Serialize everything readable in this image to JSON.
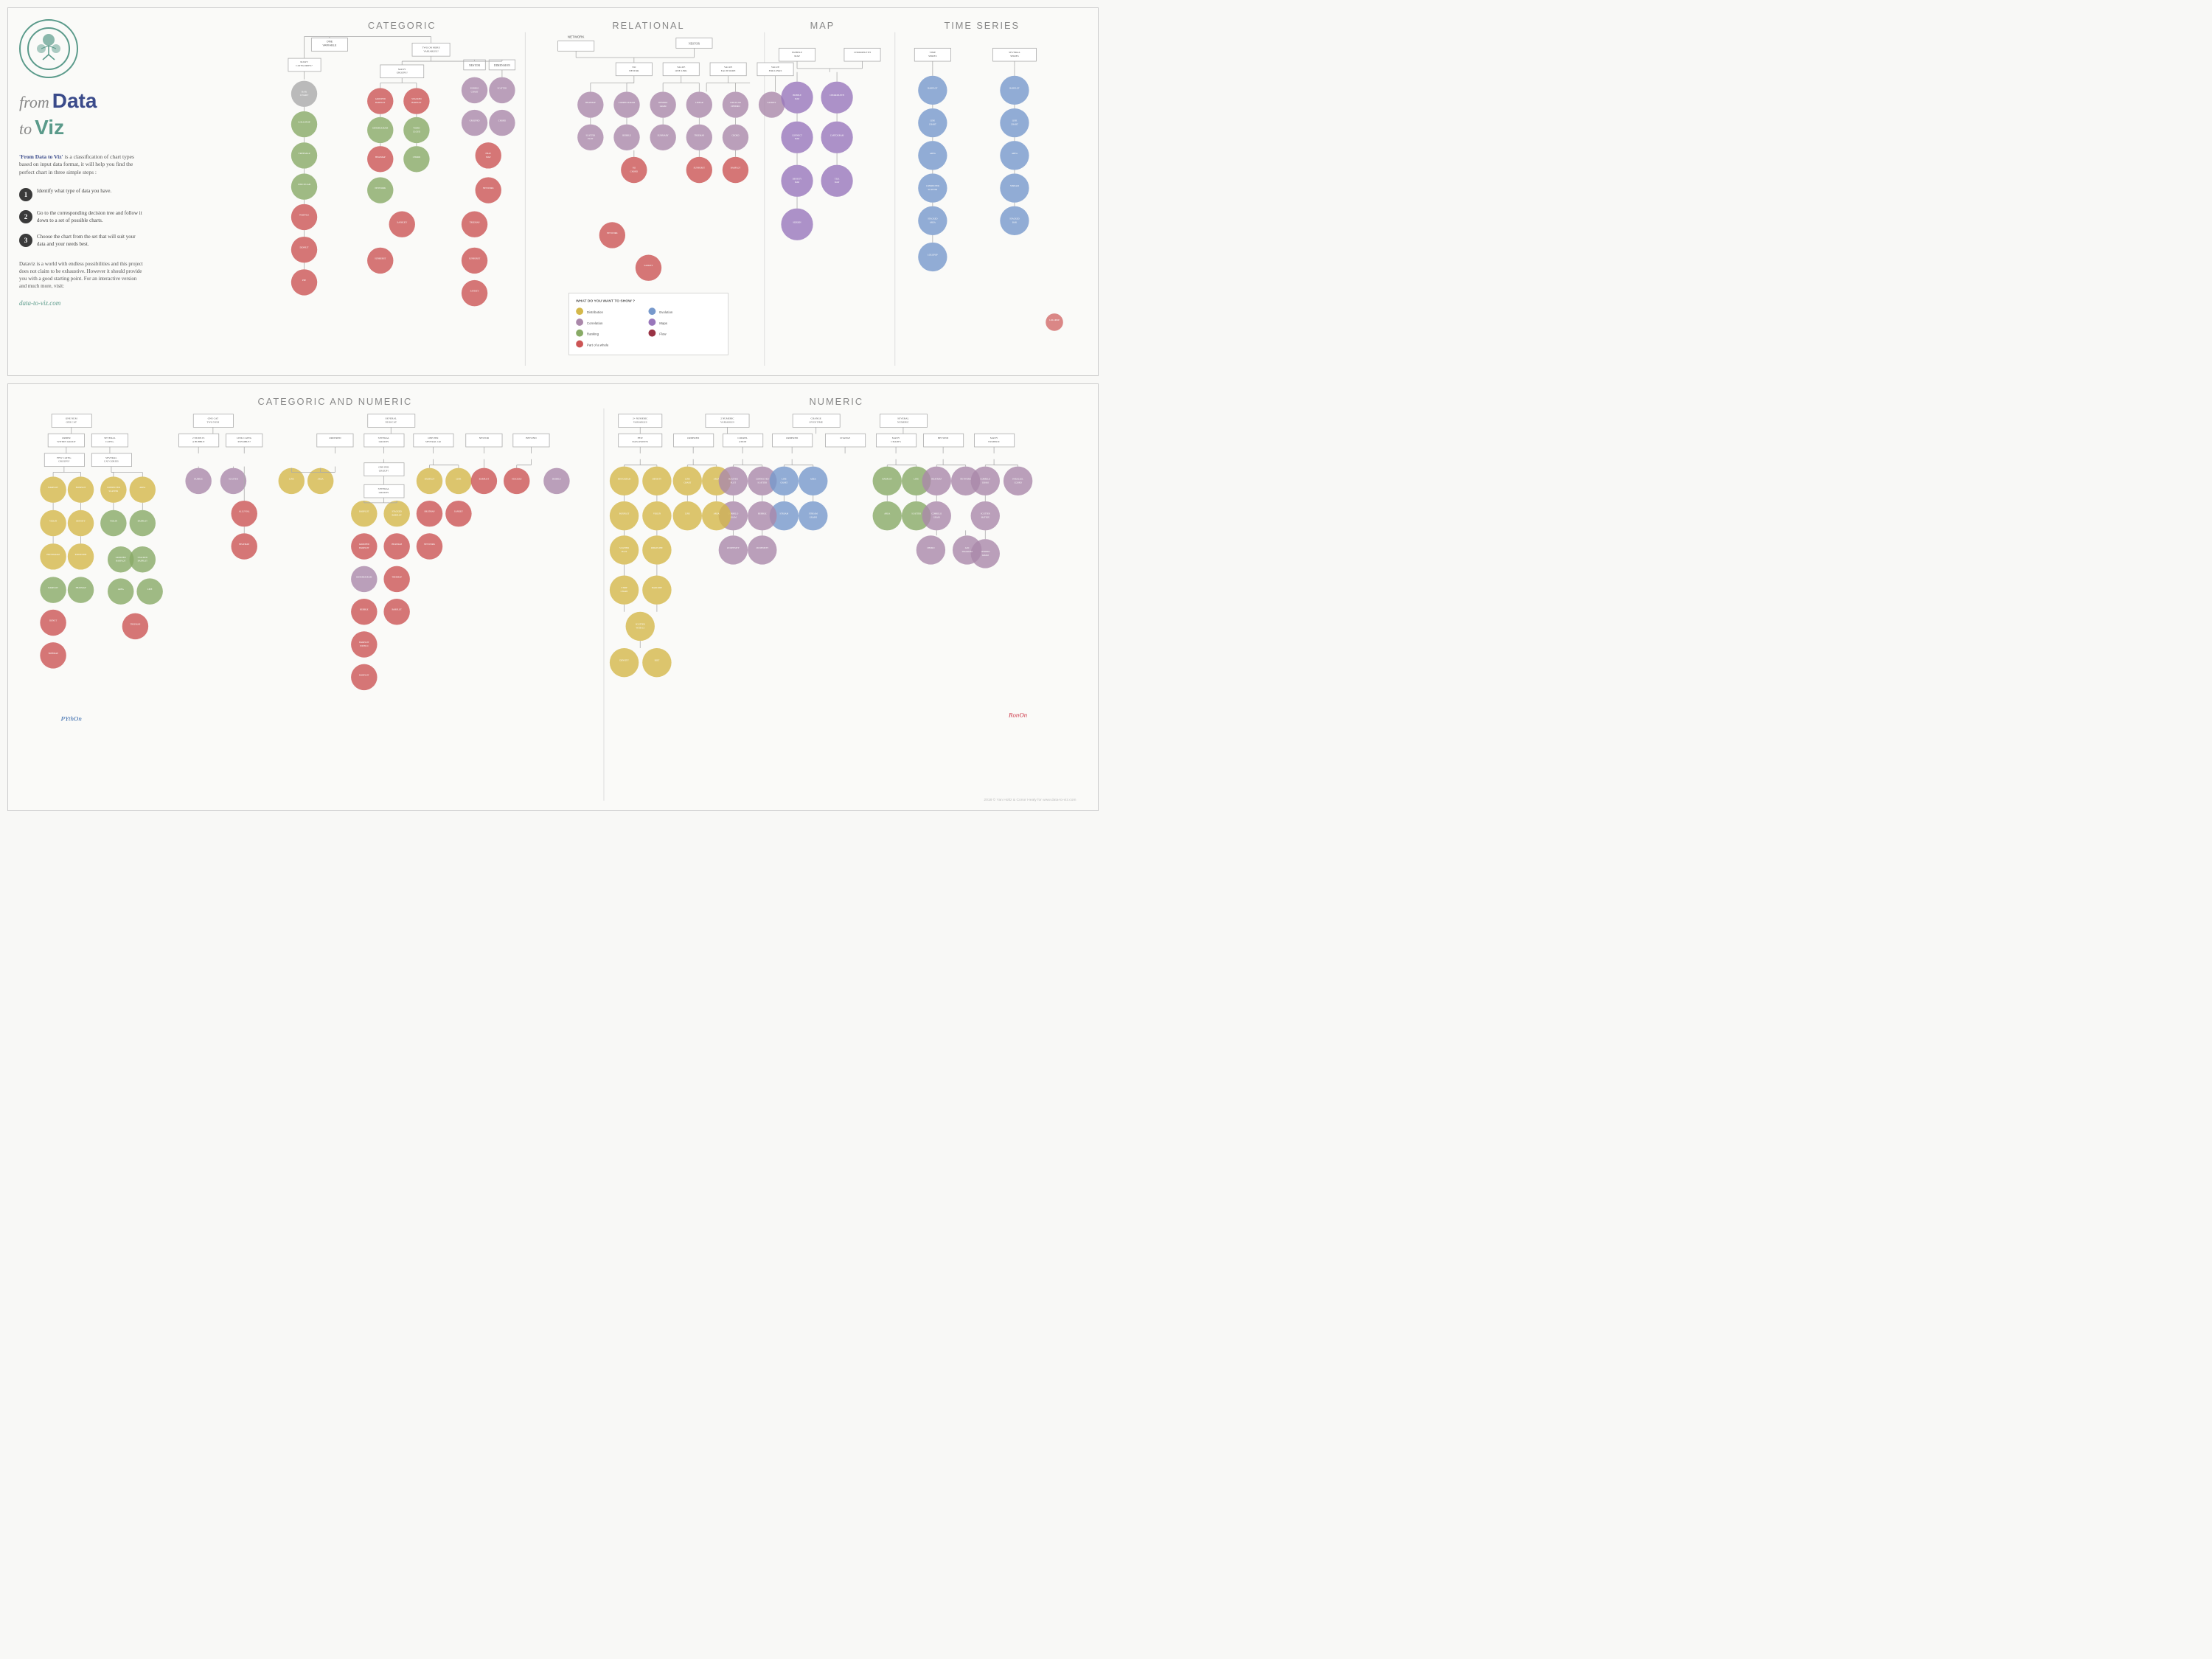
{
  "title": "From Data to Viz",
  "brand": {
    "from": "from",
    "data": "Data",
    "to": "to",
    "viz": "Viz"
  },
  "description": "'From Data to Viz' is a classification of chart types based on input data format, it will help you find the perfect chart in three simple steps :",
  "steps": [
    {
      "number": "1",
      "text": "Identify what type of data you have."
    },
    {
      "number": "2",
      "text": "Go to the corresponding decision tree and follow it down to a set of possible charts."
    },
    {
      "number": "3",
      "text": "Choose the chart from the set that will suit your data and your needs best."
    }
  ],
  "dataviz_desc": "Dataviz is a world with endless possibilities and this project does not claim to be exhaustive. However it should provide you with a good starting point. For an interactive version and much more, visit:",
  "website": "data-to-viz.com",
  "sections": {
    "top": [
      "CATEGORIC",
      "RELATIONAL",
      "MAP",
      "TIME SERIES"
    ],
    "bottom": [
      "CATEGORIC AND NUMERIC",
      "NUMERIC"
    ]
  },
  "legend": {
    "title": "WHAT DO YOU WANT TO SHOW ?",
    "items": [
      {
        "label": "Distribution",
        "color": "#d4b84a"
      },
      {
        "label": "Evolution",
        "color": "#7799cc"
      },
      {
        "label": "Correlation",
        "color": "#aa88aa"
      },
      {
        "label": "Maps",
        "color": "#9977bb"
      },
      {
        "label": "Ranking",
        "color": "#88aa66"
      },
      {
        "label": "Flow",
        "color": "#993344"
      },
      {
        "label": "Part of a whole",
        "color": "#cc5555"
      }
    ]
  },
  "footer": "2018 © Yan Holtz & Conor Healy for www.data-to-viz.com",
  "python_label": "PYthOn",
  "r_label": "RonOn"
}
